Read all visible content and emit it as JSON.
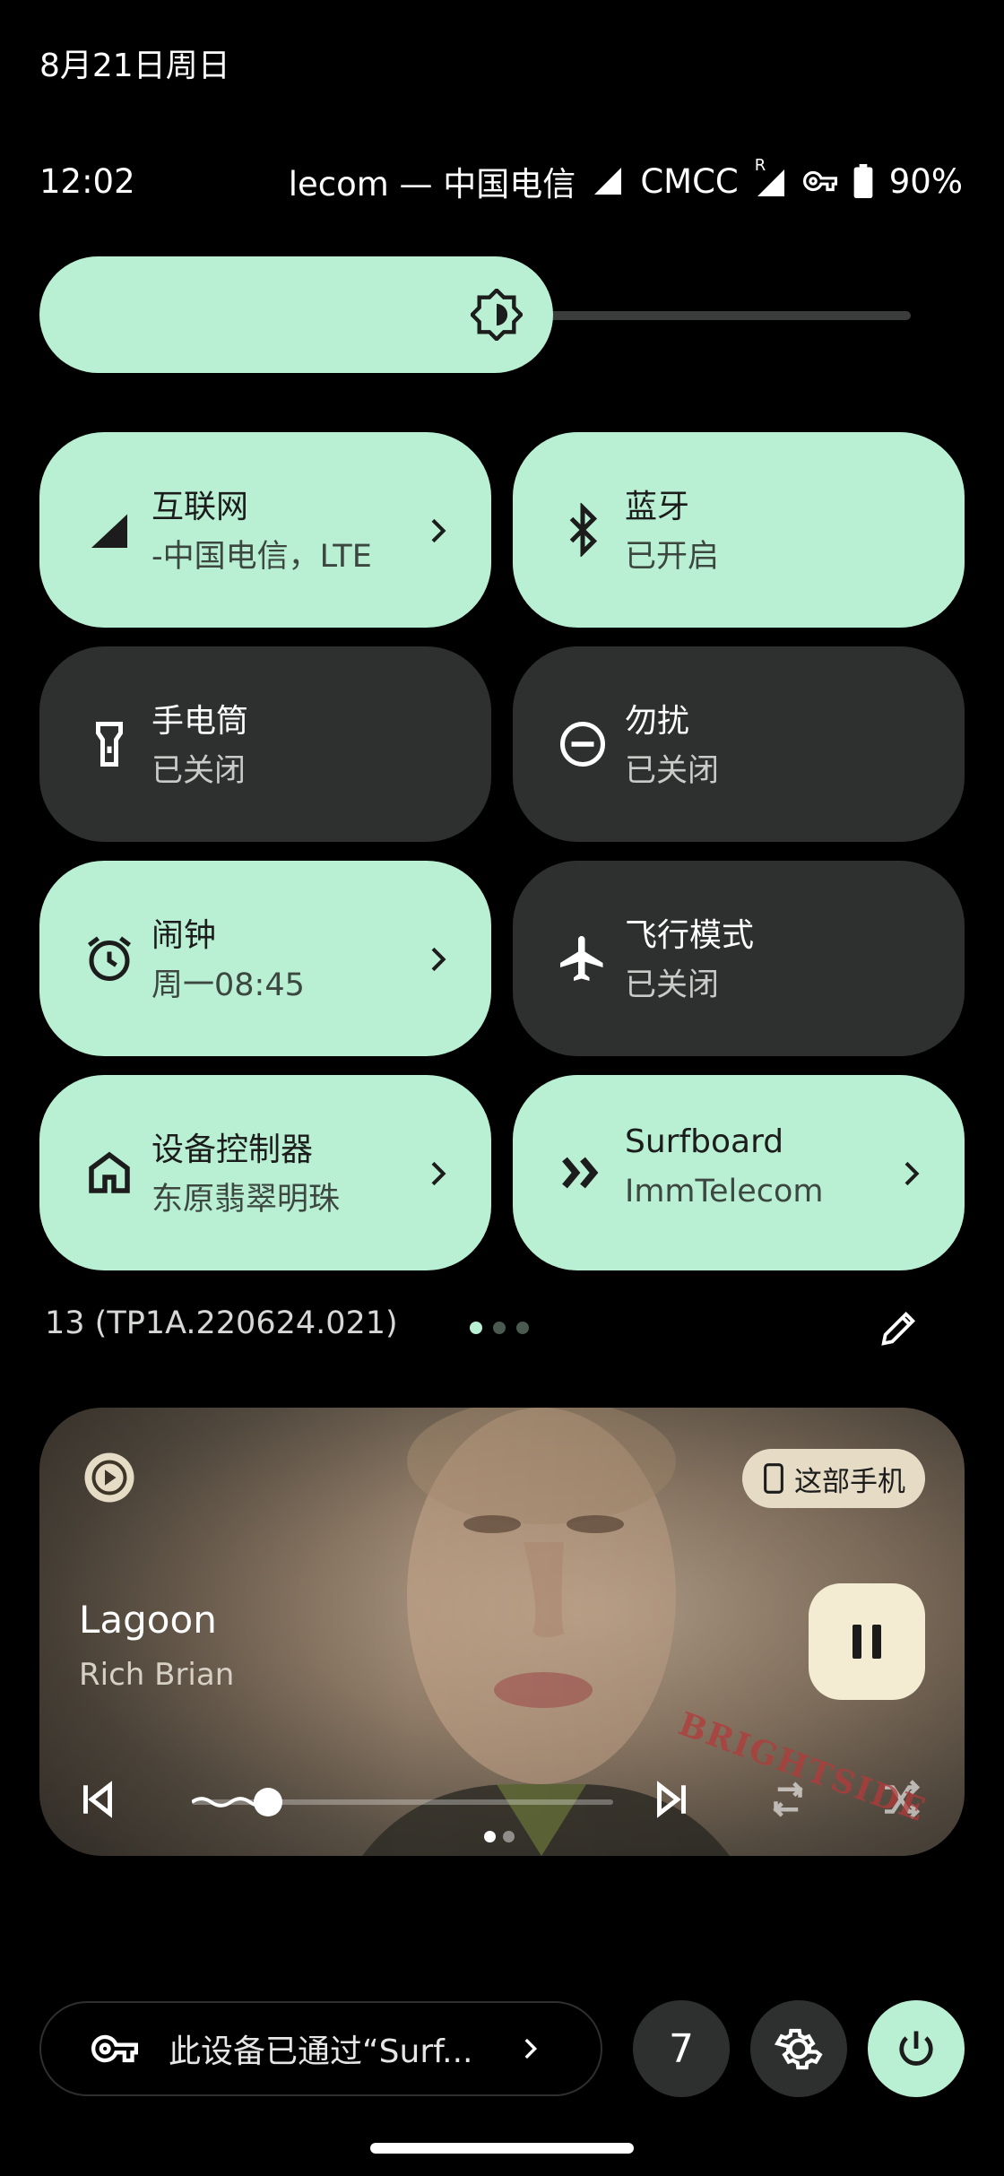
{
  "header": {
    "date": "8月21日周日",
    "time": "12:02"
  },
  "status": {
    "carriers": "lecom — 中国电信",
    "sim2": "CMCC",
    "roaming_mark": "R",
    "battery": "90%",
    "icons": [
      "signal-icon",
      "signal-roaming-icon",
      "vpn-key-icon",
      "battery-icon"
    ]
  },
  "brightness": {
    "level": 0.59
  },
  "tiles": [
    {
      "title": "互联网",
      "subtitle": "-中国电信，LTE",
      "state": "on",
      "icon": "cell-signal-icon",
      "has_chevron": true
    },
    {
      "title": "蓝牙",
      "subtitle": "已开启",
      "state": "on",
      "icon": "bluetooth-icon",
      "has_chevron": false
    },
    {
      "title": "手电筒",
      "subtitle": "已关闭",
      "state": "off",
      "icon": "flashlight-icon",
      "has_chevron": false
    },
    {
      "title": "勿扰",
      "subtitle": "已关闭",
      "state": "off",
      "icon": "do-not-disturb-icon",
      "has_chevron": false
    },
    {
      "title": "闹钟",
      "subtitle": "周一08:45",
      "state": "on",
      "icon": "alarm-icon",
      "has_chevron": true
    },
    {
      "title": "飞行模式",
      "subtitle": "已关闭",
      "state": "off",
      "icon": "airplane-icon",
      "has_chevron": false
    },
    {
      "title": "设备控制器",
      "subtitle": "东原翡翠明珠",
      "state": "on",
      "icon": "home-icon",
      "has_chevron": true
    },
    {
      "title": "Surfboard",
      "subtitle": "ImmTelecom",
      "state": "on",
      "icon": "surfboard-icon",
      "has_chevron": true
    }
  ],
  "footer_row": {
    "build": "13 (TP1A.220624.021)",
    "page_dots": 3,
    "active_page": 0
  },
  "media": {
    "title": "Lagoon",
    "artist": "Rich Brian",
    "output_device": "这部手机",
    "progress": 0.18,
    "pages": 2,
    "active_page": 0,
    "watermark": "BRIGHTSIDE"
  },
  "bottom": {
    "vpn_text": "此设备已通过“Surf...",
    "notification_count": "7"
  },
  "colors": {
    "accent": "#b9efd2",
    "tile_off": "#2e302f",
    "background": "#000000"
  }
}
